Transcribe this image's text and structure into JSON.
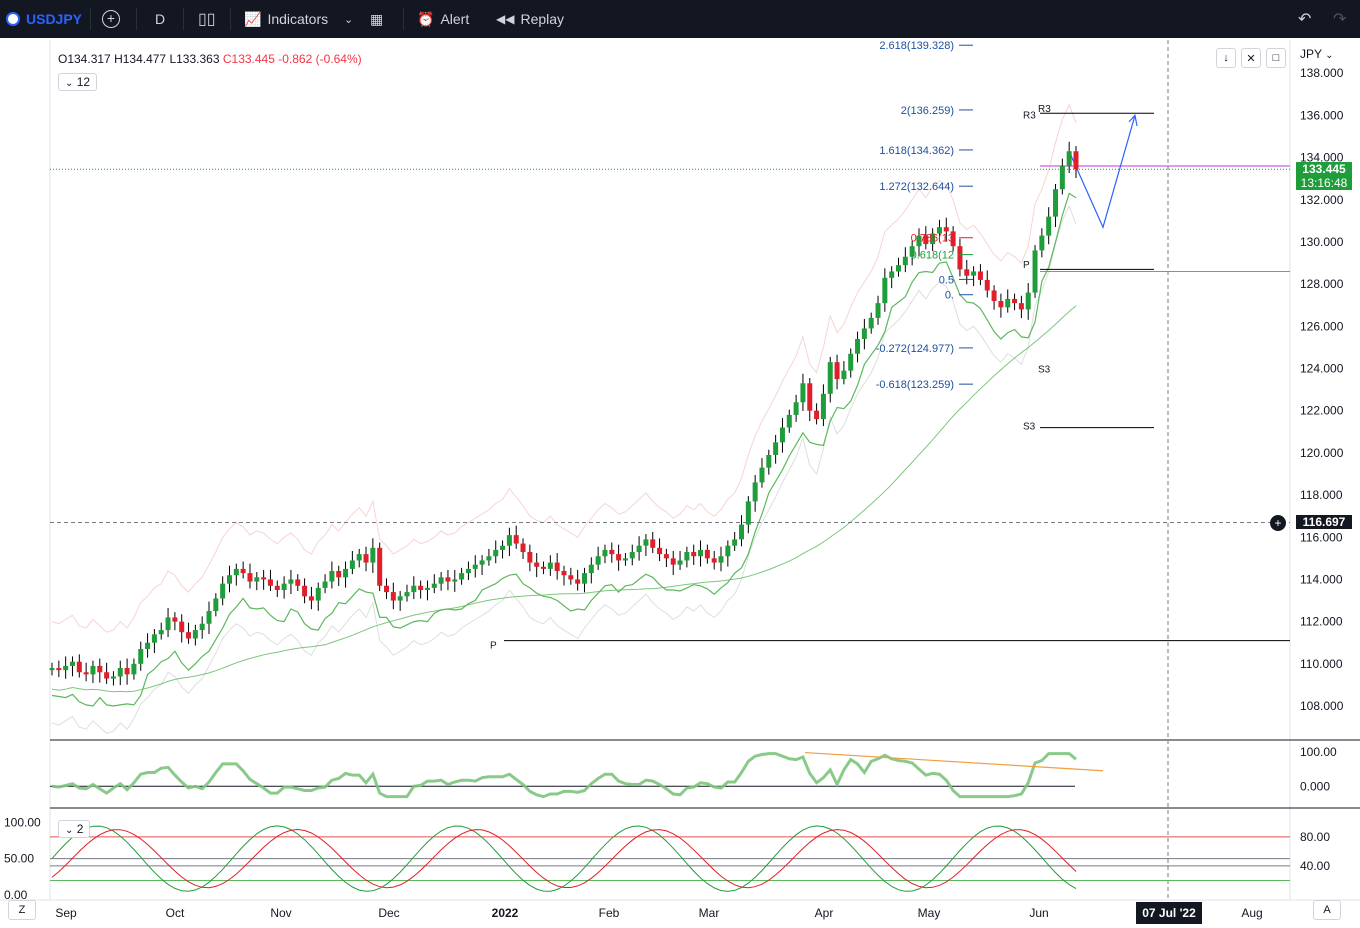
{
  "toolbar": {
    "symbol": "USDJPY",
    "interval": "D",
    "indicators_label": "Indicators",
    "alert_label": "Alert",
    "replay_label": "Replay"
  },
  "legend": {
    "open": "O134.317",
    "high": "H134.477",
    "low": "L133.363",
    "close": "C133.445",
    "change": "-0.862 (-0.64%)",
    "badge": "12",
    "stoch_badge": "2"
  },
  "price_axis": {
    "currency": "JPY",
    "last_price": "133.445",
    "countdown": "13:16:48",
    "crosshair_price": "116.697"
  },
  "time_axis": {
    "crosshair_date": "07 Jul '22",
    "left_btn": "Z",
    "right_btn": "A"
  },
  "colors": {
    "up": "#1f9d3a",
    "down": "#e01f2a",
    "fib_blue": "#1e50a0",
    "magenta": "#d05ce3",
    "pivot": "#000000",
    "ma_green": "#5cb85c",
    "band": "#f4b6b6"
  },
  "chart_data": {
    "type": "candlestick",
    "xlabels": [
      "Sep",
      "Oct",
      "Nov",
      "Dec",
      "2022",
      "Feb",
      "Mar",
      "Apr",
      "May",
      "Jun",
      "Aug"
    ],
    "ylabels": [
      "138.000",
      "136.000",
      "134.000",
      "132.000",
      "130.000",
      "128.000",
      "126.000",
      "124.000",
      "122.000",
      "120.000",
      "118.000",
      "116.000",
      "114.000",
      "112.000",
      "110.000",
      "108.000"
    ],
    "ylim": [
      107,
      140
    ],
    "fib_levels": [
      {
        "label": "2.618(139.328)",
        "price": 139.328
      },
      {
        "label": "2(136.259)",
        "price": 136.259
      },
      {
        "label": "1.618(134.362)",
        "price": 134.362
      },
      {
        "label": "1.272(132.644)",
        "price": 132.644
      },
      {
        "label": "0.786(13",
        "price": 130.2
      },
      {
        "label": "0.618(12",
        "price": 129.4
      },
      {
        "label": "0.5",
        "price": 128.224
      },
      {
        "label": "0.",
        "price": 127.499
      },
      {
        "label": "-0.272(124.977)",
        "price": 124.977
      },
      {
        "label": "-0.618(123.259)",
        "price": 123.259
      }
    ],
    "pivot_labels": [
      "R3",
      "R3",
      "P",
      "P",
      "S3",
      "S3"
    ],
    "close_series": [
      109.8,
      109.7,
      109.9,
      110.1,
      109.6,
      109.5,
      109.9,
      109.6,
      109.3,
      109.4,
      109.8,
      109.5,
      110.0,
      110.7,
      111.0,
      111.4,
      111.6,
      112.2,
      112.0,
      111.5,
      111.2,
      111.6,
      111.9,
      112.5,
      113.1,
      113.8,
      114.2,
      114.5,
      114.3,
      113.9,
      114.1,
      114.0,
      113.7,
      113.5,
      113.8,
      114.0,
      113.7,
      113.2,
      113.0,
      113.6,
      113.9,
      114.4,
      114.1,
      114.5,
      114.9,
      115.2,
      114.8,
      115.5,
      113.7,
      113.4,
      113.0,
      113.2,
      113.4,
      113.7,
      113.5,
      113.6,
      113.8,
      114.1,
      113.9,
      114.0,
      114.3,
      114.5,
      114.7,
      114.9,
      115.1,
      115.4,
      115.6,
      116.1,
      115.7,
      115.3,
      114.8,
      114.6,
      114.5,
      114.8,
      114.4,
      114.2,
      114.0,
      113.8,
      114.3,
      114.7,
      115.1,
      115.4,
      115.2,
      114.9,
      115.0,
      115.3,
      115.6,
      115.9,
      115.5,
      115.2,
      115.0,
      114.7,
      114.9,
      115.3,
      115.1,
      115.4,
      115.0,
      114.8,
      115.1,
      115.6,
      115.9,
      116.6,
      117.7,
      118.6,
      119.3,
      119.9,
      120.5,
      121.2,
      121.8,
      122.4,
      123.3,
      122.0,
      121.6,
      122.8,
      124.3,
      123.5,
      123.9,
      124.7,
      125.4,
      125.9,
      126.4,
      127.1,
      128.3,
      128.6,
      128.9,
      129.3,
      129.8,
      130.3,
      129.9,
      130.4,
      130.7,
      130.5,
      129.8,
      128.7,
      128.4,
      128.6,
      128.2,
      127.7,
      127.2,
      126.9,
      127.3,
      127.1,
      126.8,
      127.6,
      129.6,
      130.3,
      131.2,
      132.5,
      133.6,
      134.3,
      133.445
    ]
  }
}
